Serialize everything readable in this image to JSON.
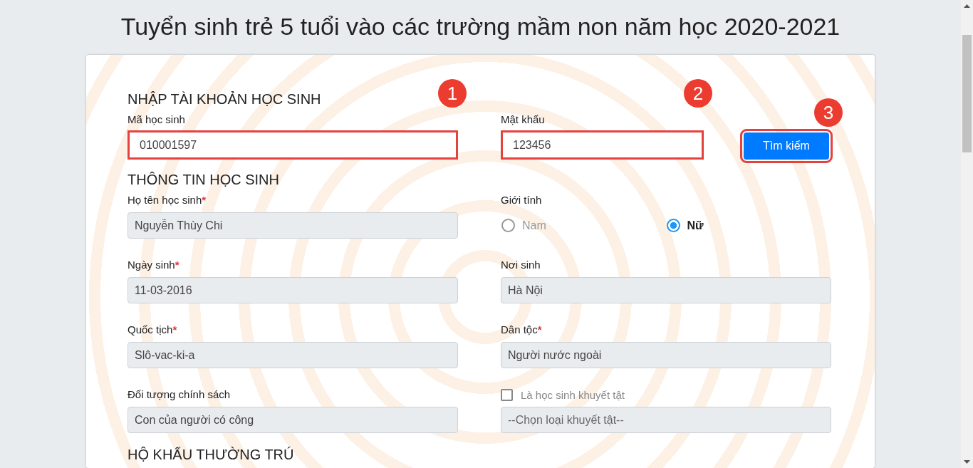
{
  "title": "Tuyển sinh trẻ 5 tuổi vào các trường mầm non năm học 2020-2021",
  "login": {
    "heading": "NHẬP TÀI KHOẢN HỌC SINH",
    "fields": [
      {
        "label": "Mã học sinh",
        "value": "010001597",
        "highlighted": true,
        "marker": "1"
      },
      {
        "label": "Mật khẩu",
        "value": "123456",
        "highlighted": true,
        "marker": "2"
      }
    ],
    "button": {
      "label": "Tìm kiếm",
      "highlighted": true,
      "marker": "3"
    }
  },
  "student": {
    "heading": "THÔNG TIN HỌC SINH",
    "fields": [
      {
        "kind": "text",
        "label": "Họ tên học sinh",
        "required_mark": "*",
        "value": "Nguyễn Thùy Chi"
      },
      {
        "kind": "radio",
        "label": "Giới tính",
        "options": [
          {
            "label": "Nam",
            "selected": false
          },
          {
            "label": "Nữ",
            "selected": true
          }
        ]
      },
      {
        "kind": "text",
        "label": "Ngày sinh",
        "required_mark": "*",
        "value": "11-03-2016"
      },
      {
        "kind": "text",
        "label": "Nơi sinh",
        "value": "Hà Nội"
      },
      {
        "kind": "text",
        "label": "Quốc tịch",
        "required_mark": "*",
        "value": "Slô-vac-ki-a"
      },
      {
        "kind": "text",
        "label": "Dân tộc",
        "required_mark": "*",
        "value": "Người nước ngoài"
      },
      {
        "kind": "text",
        "label": "Đối tượng chính sách",
        "value": "Con của người có công"
      },
      {
        "kind": "checkbox_select",
        "label": "Là học sinh khuyết tật",
        "checked": false,
        "placeholder": "--Chọn loại khuyết tật--"
      }
    ]
  },
  "residence": {
    "heading": "HỘ KHẨU THƯỜNG TRÚ"
  }
}
